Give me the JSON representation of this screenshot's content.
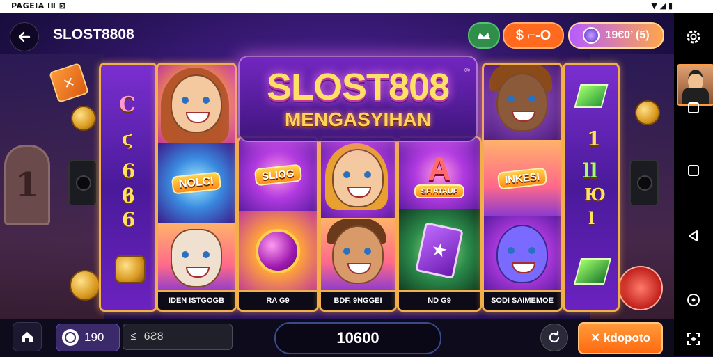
{
  "status_bar": {
    "left_text": "PAGEIA  ⅠⅡ  ⊠",
    "right_icons": [
      "wifi-icon",
      "signal-icon",
      "battery-icon"
    ]
  },
  "header": {
    "title": "SLOST8808",
    "currency_pill": "$ ⌐-O",
    "gem_pill": "19€0’ (5)"
  },
  "logo": {
    "main": "SLOST808",
    "sub": "MENGASYIHAN",
    "reg": "®"
  },
  "reels": {
    "reel1": [
      "C",
      "ϛ",
      "6",
      "ϐ",
      "6"
    ],
    "reel2_label": "IDEN ISTGOGB",
    "reel2_symbol": "NOLCI",
    "reel3_label": "RA G9",
    "reel3_symbol": "SLIOG",
    "reel4_label": "BDF. 9NGGEI",
    "reel5_label": "ND G9",
    "reel5_symbol": "SFIATAUF",
    "reel6_label": "SODI SAIMEMOE",
    "reel6_symbol": "INKESI",
    "reel7": [
      "1",
      "ll",
      "Ю",
      "l"
    ]
  },
  "bottom": {
    "balance": "190",
    "bet": "≤ 6Ƨ8",
    "win": "10600",
    "spin_label": "✕ kdopoto"
  },
  "colors": {
    "accent_orange": "#ff6a1f",
    "gold_border": "#f0b04a",
    "bg_purple": "#3a1a78"
  }
}
